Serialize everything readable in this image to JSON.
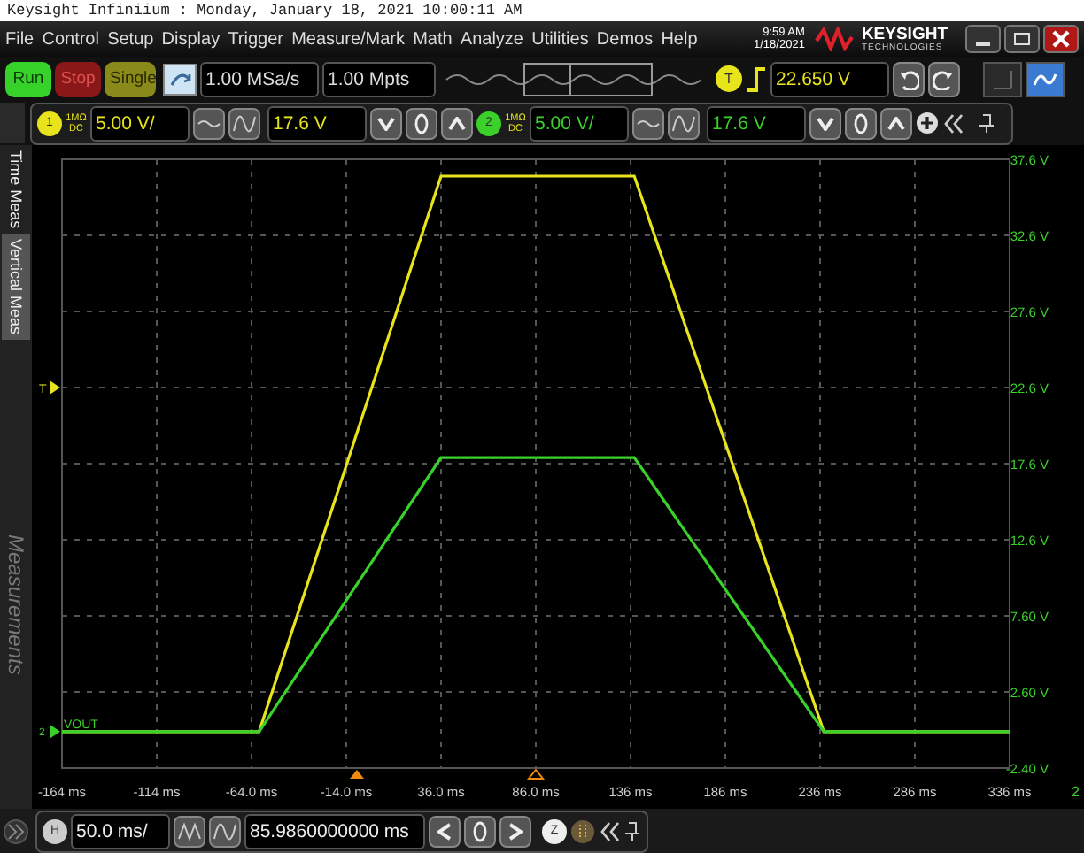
{
  "title_bar": {
    "text": "Keysight Infiniium : Monday, January 18, 2021 10:00:11 AM"
  },
  "menu": [
    "File",
    "Control",
    "Setup",
    "Display",
    "Trigger",
    "Measure/Mark",
    "Math",
    "Analyze",
    "Utilities",
    "Demos",
    "Help"
  ],
  "clock": {
    "time": "9:59 AM",
    "date": "1/18/2021"
  },
  "logo": {
    "name": "KEYSIGHT",
    "sub": "TECHNOLOGIES"
  },
  "acquisition": [
    {
      "label": "Run",
      "kind": "run",
      "selected": true
    },
    {
      "label": "Stop",
      "kind": "stop",
      "selected": false
    },
    {
      "label": "Single",
      "kind": "single",
      "selected": false
    }
  ],
  "toolbar": {
    "sample_rate": "1.00 MSa/s",
    "memory_depth": "1.00 Mpts",
    "trigger_badge": "T",
    "trigger_level": "22.650 V"
  },
  "channels": [
    {
      "number": "1",
      "impedance": "1MΩ",
      "coupling": "DC",
      "color": "#e8e41c",
      "scale": "5.00 V/",
      "offset": "17.6 V"
    },
    {
      "number": "2",
      "impedance": "1MΩ",
      "coupling": "DC",
      "color": "#3ad12a",
      "scale": "5.00 V/",
      "offset": "17.6 V"
    }
  ],
  "side_tabs": [
    {
      "label": "Time Meas",
      "selected": false
    },
    {
      "label": "Vertical Meas",
      "selected": true
    }
  ],
  "side_panel_title": "Measurements",
  "plot": {
    "trigger_marker": "T",
    "ground_marker": "2",
    "ground_label": "VOUT",
    "edge_label": "2",
    "chart_data": {
      "type": "line",
      "x": [
        -164,
        -60,
        36,
        138,
        238,
        336
      ],
      "series": [
        {
          "color": "#e8e41c",
          "values": [
            0,
            0,
            36.5,
            36.5,
            0,
            0
          ]
        },
        {
          "color": "#3ad12a",
          "values": [
            0,
            0,
            18,
            18,
            0,
            0
          ]
        }
      ],
      "grid": true,
      "xlim": [
        -164,
        336
      ],
      "ylim": [
        -2.4,
        37.6
      ],
      "xticks": [
        {
          "value": -164,
          "label": "-164 ms"
        },
        {
          "value": -114,
          "label": "-114 ms"
        },
        {
          "value": -64,
          "label": "-64.0 ms"
        },
        {
          "value": -14,
          "label": "-14.0 ms"
        },
        {
          "value": 36,
          "label": "36.0 ms"
        },
        {
          "value": 86,
          "label": "86.0 ms"
        },
        {
          "value": 136,
          "label": "136 ms"
        },
        {
          "value": 186,
          "label": "186 ms"
        },
        {
          "value": 236,
          "label": "236 ms"
        },
        {
          "value": 286,
          "label": "286 ms"
        },
        {
          "value": 336,
          "label": "336 ms"
        }
      ],
      "yticks": [
        {
          "value": 37.6,
          "label": "37.6 V"
        },
        {
          "value": 32.6,
          "label": "32.6 V"
        },
        {
          "value": 27.6,
          "label": "27.6 V"
        },
        {
          "value": 22.6,
          "label": "22.6 V"
        },
        {
          "value": 17.6,
          "label": "17.6 V"
        },
        {
          "value": 12.6,
          "label": "12.6 V"
        },
        {
          "value": 7.6,
          "label": "7.60 V"
        },
        {
          "value": 2.6,
          "label": "2.60 V"
        },
        {
          "value": -2.4,
          "label": "-2.40 V"
        }
      ]
    }
  },
  "timebase": {
    "badge": "H",
    "scale": "50.0 ms/",
    "position": "85.9860000000 ms",
    "zoom_badge": "Z"
  }
}
